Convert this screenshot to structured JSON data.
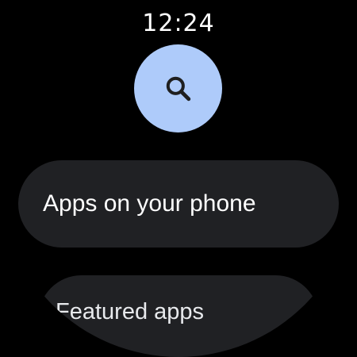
{
  "status": {
    "time": "12:24"
  },
  "search": {
    "icon": "search-icon"
  },
  "menu": {
    "items": [
      {
        "label": "Apps on your phone"
      },
      {
        "label": "Featured apps"
      }
    ]
  },
  "colors": {
    "background": "#000000",
    "accent": "#aecbfa",
    "chip": "#202124",
    "text": "#ffffff"
  }
}
